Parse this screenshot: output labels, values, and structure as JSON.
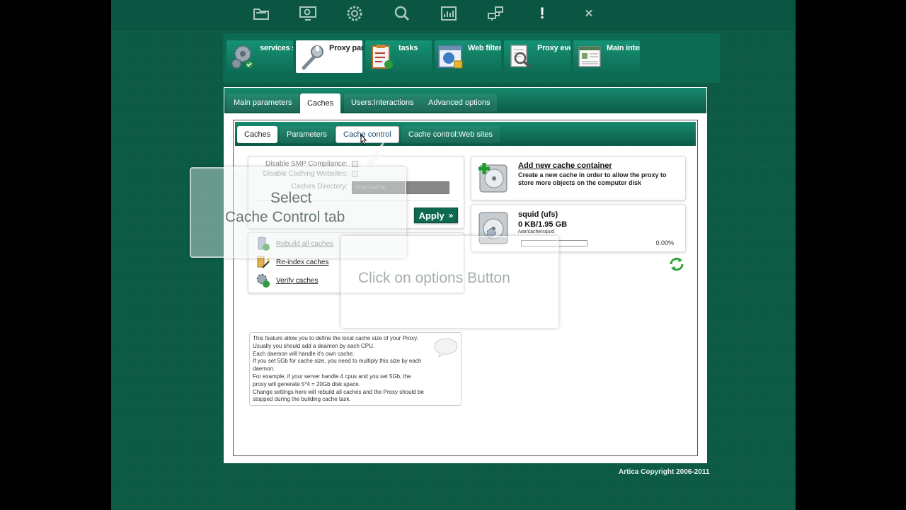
{
  "topbar": {
    "icons": [
      "folder-icon",
      "monitor-icon",
      "gear-icon",
      "search-icon",
      "chart-icon",
      "network-icon",
      "alert-icon",
      "close-icon"
    ],
    "alert_glyph": "!",
    "close_glyph": "✕"
  },
  "categories": [
    {
      "label": "services s",
      "icon": "gears-icon"
    },
    {
      "label": "Proxy para",
      "icon": "wrench-icon"
    },
    {
      "label": "tasks",
      "icon": "clipboard-icon"
    },
    {
      "label": "Web filteri",
      "icon": "web-lock-icon"
    },
    {
      "label": "Proxy eve",
      "icon": "magnifier-doc-icon"
    },
    {
      "label": "Main inter",
      "icon": "document-icon"
    }
  ],
  "main_tabs": [
    "Main parameters",
    "Caches",
    "Users:Interactions",
    "Advanced options"
  ],
  "sub_tabs": [
    "Caches",
    "Parameters",
    "Cache control",
    "Cache control:Web sites"
  ],
  "form": {
    "smp_label": "Disable SMP Compliance:",
    "caching_label": "Disable Caching Websites:",
    "dir_label": "Caches Directory:",
    "dir_value": "/var/cache",
    "apply_label": "Apply",
    "apply_glyph": "»"
  },
  "actions": [
    "Rebuild all caches",
    "Re-index caches",
    "Verify caches"
  ],
  "help_text": [
    "This feature allow you to define the local cache size of your Proxy.",
    "Usually you should add a deamon by each CPU.",
    "Each daemon will handle it's own cache.",
    "If you set 5Gb for cache size, you need to multiply this size by each",
    "daemon.",
    "For example, if your server handle 4 cpus and you set 5Gb, the",
    "proxy will generate 5*4 = 20Gb disk space.",
    "Change settings here will rebuild all caches and the Proxy should be",
    "stopped during the building cache task."
  ],
  "add_cache": {
    "title": "Add new cache container",
    "desc": "Create a new cache in order to allow the proxy to store more objects on the computer disk"
  },
  "squid": {
    "name": "squid (ufs)",
    "usage": "0 KB/1.95 GB",
    "path": "/var/cache/squid",
    "percent": "0.00%",
    "fill": 0
  },
  "overlays": {
    "select_line1": "Select",
    "select_line2": "Cache Control tab",
    "options_hint": "Click on options Button"
  },
  "footer": "Artica Copyright 2006-2011",
  "colors": {
    "background": "#0b5b45",
    "tab_bar": "#0b5a46",
    "accent": "#0d6a50"
  }
}
